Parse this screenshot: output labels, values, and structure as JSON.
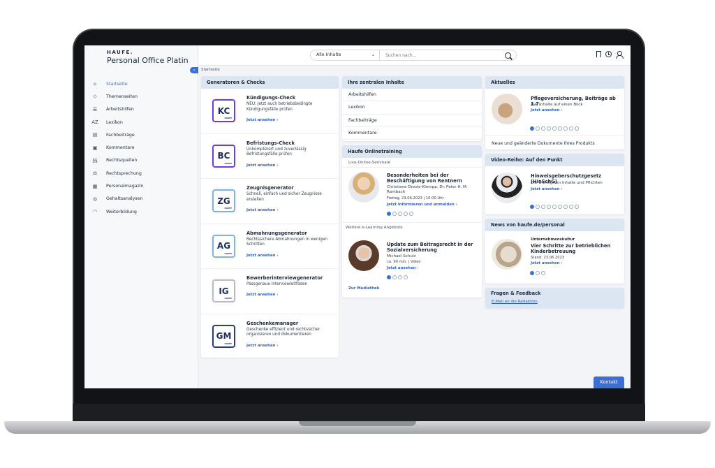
{
  "header": {
    "brand_logo": "HAUFE.",
    "product_name": "Personal Office Platin",
    "scope_select": "Alle Inhalte",
    "search_placeholder": "Suchen nach...",
    "breadcrumb": "Startseite"
  },
  "sidebar": {
    "items": [
      {
        "label": "Startseite",
        "icon": "home-icon",
        "glyph": "⌂"
      },
      {
        "label": "Themenseiten",
        "icon": "tag-icon",
        "glyph": "◇"
      },
      {
        "label": "Arbeitshilfen",
        "icon": "checklist-icon",
        "glyph": "☰"
      },
      {
        "label": "Lexikon",
        "icon": "az-icon",
        "glyph": "AZ"
      },
      {
        "label": "Fachbeiträge",
        "icon": "article-icon",
        "glyph": "▤"
      },
      {
        "label": "Kommentare",
        "icon": "comment-icon",
        "glyph": "▣"
      },
      {
        "label": "Rechtsquellen",
        "icon": "paragraph-icon",
        "glyph": "§§"
      },
      {
        "label": "Rechtsprechung",
        "icon": "gavel-icon",
        "glyph": "⚖"
      },
      {
        "label": "Personalmagazin",
        "icon": "magazine-icon",
        "glyph": "▦"
      },
      {
        "label": "Gehaltsanalysen",
        "icon": "analysis-icon",
        "glyph": "◎"
      },
      {
        "label": "Weiterbildung",
        "icon": "education-icon",
        "glyph": "◠"
      }
    ]
  },
  "generators": {
    "title": "Generatoren & Checks",
    "badge_sub": "HAUFE",
    "items": [
      {
        "abbr": "KC",
        "title": "Kündigungs-Check",
        "desc": "NEU: Jetzt auch betriebsbedingte Kündigungsfälle prüfen",
        "link": "Jetzt ansehen  ›",
        "color": "#6a3fd1"
      },
      {
        "abbr": "BC",
        "title": "Befristungs-Check",
        "desc": "Unkompliziert und zuverlässig Befristungsfälle prüfen",
        "link": "Jetzt ansehen  ›",
        "color": "#6a3fd1"
      },
      {
        "abbr": "ZG",
        "title": "Zeugnisgenerator",
        "desc": "Schnell, einfach und sicher Zeugnisse erstellen",
        "link": "Jetzt ansehen  ›",
        "color": "#7fb4e0"
      },
      {
        "abbr": "AG",
        "title": "Abmahnungsgenerator",
        "desc": "Rechtssichere Abmahnungen in wenigen Schritten",
        "link": "Jetzt ansehen  ›",
        "color": "#7fb4e0"
      },
      {
        "abbr": "IG",
        "title": "Bewerberinterviewgenerator",
        "desc": "Passgenaue Interviewleitfäden",
        "link": "Jetzt ansehen  ›",
        "color": "#b8bcc4"
      },
      {
        "abbr": "GM",
        "title": "Geschenkemanager",
        "desc": "Geschenke effizient und rechtssicher organisieren und dokumentieren",
        "link": "Jetzt ansehen  ›",
        "color": "#2a3f6e"
      }
    ]
  },
  "central": {
    "title": "Ihre zentralen Inhalte",
    "items": [
      "Arbeitshilfen",
      "Lexikon",
      "Fachbeiträge",
      "Kommentare"
    ]
  },
  "training": {
    "title": "Haufe Onlinetraining",
    "subtitle": "Live-Online-Seminare",
    "seminar": {
      "title": "Besonderheiten bei der Beschäftigung von Rentnern",
      "speakers": "Christiane Droste-Klempp, Dr. Peter H. M. Rambach",
      "date": "Freitag, 23.06.2023 | 10:00 Uhr",
      "link": "Jetzt informieren und anmelden  ›"
    },
    "elearning_label": "Weitere e-Learning Angebote",
    "elearning": {
      "title": "Update zum Beitragsrecht in der Sozialversicherung",
      "speaker": "Michael Schulz",
      "meta": "ca. 90 min. | Video",
      "link": "Jetzt ansehen  ›"
    },
    "mediathek_link": "Zur Mediathek"
  },
  "news": {
    "title": "Aktuelles",
    "item": {
      "title": "Pflegeversicherung, Beiträge ab 1.7.",
      "desc": "Alle Inhalte auf einen Blick",
      "link": "Jetzt ansehen  ›"
    },
    "footer": "Neue und geänderte Dokumente Ihres Produkts"
  },
  "video": {
    "title": "Video-Reihe: Auf den Punkt",
    "item": {
      "title": "Hinweisgeberschutzgesetz (HinSchG)",
      "desc": "Die wichtigsten Inhalte und Pflichten",
      "link": "Jetzt ansehen  ›"
    }
  },
  "haufe_news": {
    "title": "News von haufe.de/personal",
    "item": {
      "category": "Unternehmenskultur",
      "title": "Vier Schritte zur betrieblichen Kinderbetreuung",
      "date": "Stand: 23.06.2023",
      "link": "Jetzt ansehen  ›"
    }
  },
  "feedback": {
    "title": "Fragen & Feedback",
    "link": "E-Mail an die Redaktion"
  },
  "contact_button": "Kontakt",
  "colors": {
    "accent": "#3b6fd6",
    "panel_header": "#dce6f2"
  }
}
